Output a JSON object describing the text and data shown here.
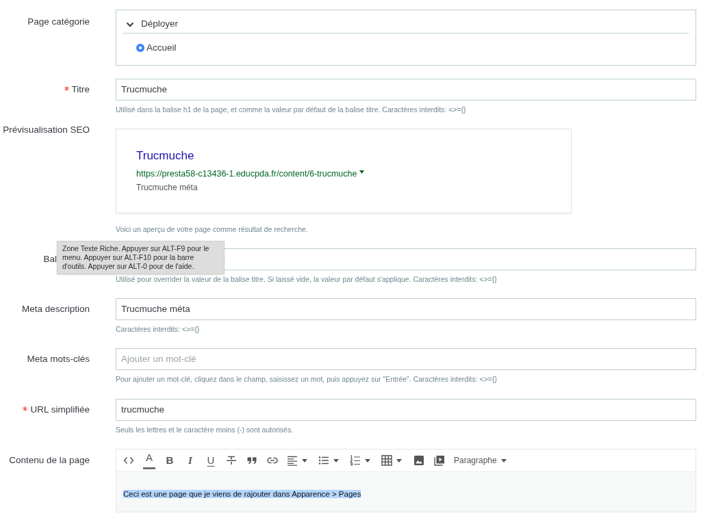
{
  "form": {
    "fields": [
      {
        "kind": "category_tree",
        "label": "Page catégorie",
        "required": false,
        "toggle": "Déployer",
        "options": [
          {
            "label": "Accueil",
            "selected": true
          }
        ]
      },
      {
        "kind": "text",
        "label": "Titre",
        "required": true,
        "value": "Trucmuche",
        "help": "Utilisé dans la balise h1 de la page, et comme la valeur par défaut de la balise titre. Caractères interdits: <>={}"
      },
      {
        "kind": "seo_preview",
        "label": "Prévisualisation SEO",
        "required": false,
        "preview": {
          "title": "Trucmuche",
          "url": "https://presta58-c13436-1.educpda.fr/content/6-trucmuche",
          "description": "Trucmuche méta"
        },
        "help": "Voici un aperçu de votre page comme résultat de recherche."
      },
      {
        "kind": "text",
        "label": "Bal",
        "required": false,
        "tooltip": "Zone Texte Riche. Appuyer sur ALT-F9 pour le menu. Appuyer sur ALT-F10 pour la barre d'outils. Appuyer sur ALT-0 pour de l'aide.",
        "help": "Utilisé pour overrider la valeur de la balise titre. Si laissé vide, la valeur par défaut s'applique. Caractères interdits: <>={}"
      },
      {
        "kind": "text",
        "label": "Meta description",
        "required": false,
        "value": "Trucmuche méta",
        "help": "Caractères interdits: <>={}"
      },
      {
        "kind": "tags",
        "label": "Meta mots-clés",
        "required": false,
        "placeholder": "Ajouter un mot-clé",
        "help": "Pour ajouter un mot-clé, cliquez dans le champ, saisissez un mot, puis appuyez sur \"Entrée\". Caractères interdits: <>={}"
      },
      {
        "kind": "text",
        "label": "URL simplifiée",
        "required": true,
        "value": "trucmuche",
        "help": "Seuls les lettres et le caractère moins (-) sont autorisés."
      },
      {
        "kind": "editor",
        "label": "Contenu de la page",
        "required": false,
        "toolbar": [
          {
            "kind": "source_code",
            "menu": false
          },
          {
            "kind": "text_color",
            "label": "A",
            "menu": false
          },
          {
            "kind": "bold",
            "label": "B",
            "menu": false
          },
          {
            "kind": "italic",
            "label": "I",
            "menu": false
          },
          {
            "kind": "underline",
            "label": "U",
            "menu": false
          },
          {
            "kind": "strikethrough",
            "menu": false
          },
          {
            "kind": "blockquote",
            "menu": false
          },
          {
            "kind": "link",
            "menu": false
          },
          {
            "kind": "align",
            "menu": true
          },
          {
            "kind": "bullet_list",
            "menu": true
          },
          {
            "kind": "numbered_list",
            "menu": true
          },
          {
            "kind": "table",
            "menu": true
          },
          {
            "kind": "image",
            "menu": false
          },
          {
            "kind": "media",
            "menu": false
          },
          {
            "kind": "format",
            "label": "Paragraphe",
            "menu": true
          }
        ],
        "content": {
          "text": "Ceci est une page que je viens de rajouter dans Apparence > Pages",
          "selected": true
        }
      }
    ]
  }
}
